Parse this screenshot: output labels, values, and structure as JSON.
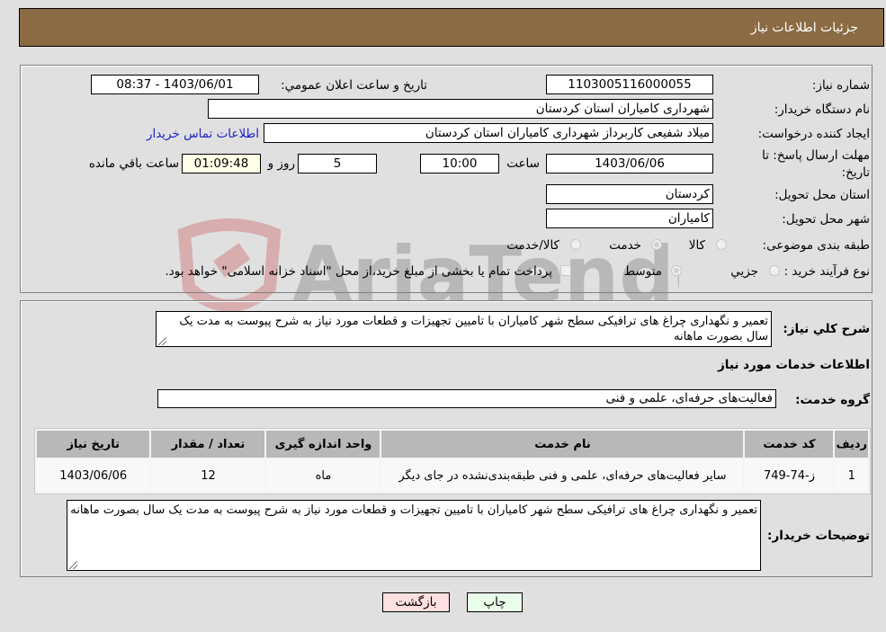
{
  "header": {
    "title": "جزئیات اطلاعات نیاز"
  },
  "form": {
    "need_number_label": "شماره نیاز:",
    "need_number": "1103005116000055",
    "announce_label": "تاریخ و ساعت اعلان عمومي:",
    "announce_value": "1403/06/01 - 08:37",
    "buyer_org_label": "نام دستگاه خریدار:",
    "buyer_org": "شهرداری کامیاران استان کردستان",
    "creator_label": "ایجاد کننده درخواست:",
    "creator": "میلاد شفیعی کاربرداز شهرداری کامیاران استان کردستان",
    "contact_link": "اطلاعات تماس خریدار",
    "deadline_label_1": "مهلت ارسال پاسخ: تا",
    "deadline_label_2": "تاریخ:",
    "deadline_date": "1403/06/06",
    "time_label": "ساعت",
    "deadline_time": "10:00",
    "days_value": "5",
    "days_label": "روز و",
    "remaining_time": "01:09:48",
    "remaining_label": "ساعت باقي مانده",
    "province_label": "استان محل تحویل:",
    "province": "کردستان",
    "city_label": "شهر محل تحویل:",
    "city": "کامیاران",
    "category_label": "طبقه بندی موضوعی:",
    "category_options": [
      "کالا",
      "خدمت",
      "کالا/خدمت"
    ],
    "category_selected": "خدمت",
    "process_label": "نوع فرآیند خرید :",
    "process_options": [
      "جزیي",
      "متوسط"
    ],
    "process_selected": "متوسط",
    "treasury_note": "پرداخت تمام یا بخشی از مبلغ خرید،از محل \"اسناد خزانه اسلامی\" خواهد بود."
  },
  "details": {
    "summary_label": "شرح کلي نیاز:",
    "summary": "تعمیر و نگهداری چراغ های ترافیکی سطح شهر کامیاران با تامیین تجهیزات و قطعات مورد نیاز به شرح پیوست به مدت یک سال بصورت ماهانه",
    "services_heading": "اطلاعات خدمات مورد نیاز",
    "service_group_label": "گروه خدمت:",
    "service_group": "فعالیت‌های حرفه‌ای، علمی و فنی",
    "table": {
      "headers": [
        "ردیف",
        "کد خدمت",
        "نام خدمت",
        "واحد اندازه گیری",
        "تعداد / مقدار",
        "تاریخ نیاز"
      ],
      "rows": [
        [
          "1",
          "ز-74-749",
          "سایر فعالیت‌های حرفه‌ای، علمی و فنی طبقه‌بندی‌نشده در جای دیگر",
          "ماه",
          "12",
          "1403/06/06"
        ]
      ]
    },
    "buyer_notes_label": "توضیحات خریدار:",
    "buyer_notes": "تعمیر و نگهداری چراغ های ترافیکی سطح شهر کامیاران با تامیین تجهیزات و قطعات مورد نیاز به شرح پیوست به مدت یک سال بصورت ماهانه"
  },
  "buttons": {
    "print": "چاپ",
    "back": "بازگشت"
  },
  "watermark": {
    "text": "AriaTender.neT"
  },
  "colors": {
    "header_bg": "#8b6b43",
    "print_bg": "#eaffea",
    "back_bg": "#ffe0e0",
    "remaining_bg": "#ffffe8",
    "link": "#1e1ec8"
  }
}
